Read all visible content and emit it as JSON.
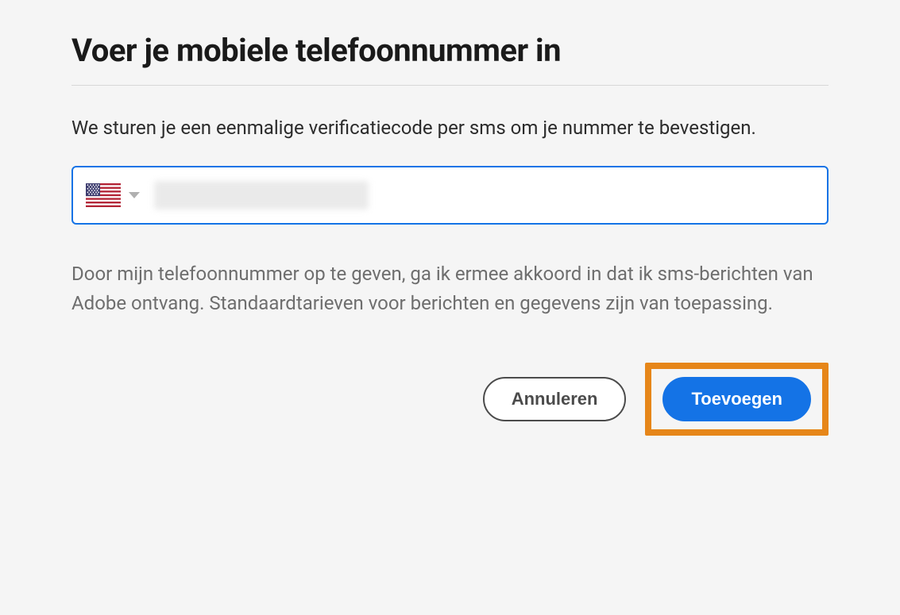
{
  "dialog": {
    "title": "Voer je mobiele telefoonnummer in",
    "description": "We sturen je een eenmalige verificatiecode per sms om je nummer te bevestigen.",
    "country": {
      "flag_name": "us-flag"
    },
    "phone_value": "",
    "disclaimer": "Door mijn telefoonnummer op te geven, ga ik ermee akkoord in dat ik sms-berichten van Adobe ontvang. Standaardtarieven voor berichten en gegevens zijn van toepassing.",
    "buttons": {
      "cancel": "Annuleren",
      "add": "Toevoegen"
    }
  },
  "colors": {
    "accent": "#1473e6",
    "highlight": "#e68619"
  }
}
